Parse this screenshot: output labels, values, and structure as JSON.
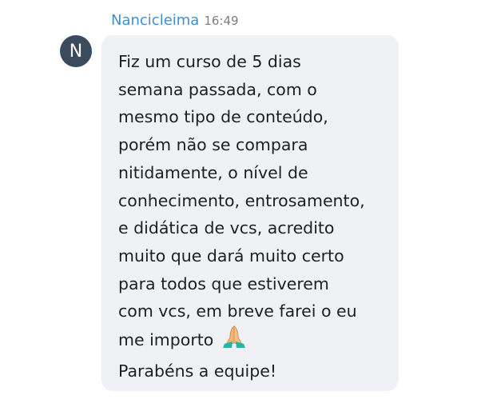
{
  "message": {
    "sender": "Nancicleima",
    "time": "16:49",
    "avatar_initial": "N",
    "lines": [
      "Fiz um curso de 5 dias",
      "semana passada, com o",
      "mesmo tipo de conteúdo,",
      "porém não se compara",
      "nitidamente, o nível de",
      "conhecimento, entrosamento,",
      "e didática de vcs, acredito",
      "muito que dará muito certo",
      "para todos que estiverem",
      "com vcs, em breve farei o eu",
      "me importo ",
      "Parabéns a equipe!"
    ],
    "emoji": "folded-hands-icon"
  },
  "colors": {
    "sender": "#3d8ed6",
    "avatar_bg": "#3c4a5d",
    "bubble_bg": "#f0f1f4"
  }
}
